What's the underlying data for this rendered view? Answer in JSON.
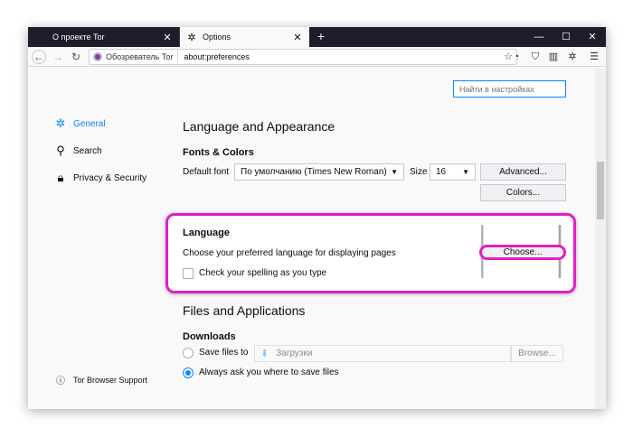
{
  "tabs": [
    {
      "title": "О проекте Tor",
      "active": false
    },
    {
      "title": "Options",
      "active": true
    }
  ],
  "window_controls": {
    "minimize": "—",
    "maximize": "☐",
    "close": "✕"
  },
  "navbar": {
    "identity_label": "Обозреватель Tor",
    "url": "about:preferences"
  },
  "search": {
    "placeholder": "Найти в настройках"
  },
  "sidebar": {
    "items": [
      {
        "label": "General",
        "icon": "gear-icon",
        "selected": true
      },
      {
        "label": "Search",
        "icon": "search-icon",
        "selected": false
      },
      {
        "label": "Privacy & Security",
        "icon": "lock-icon",
        "selected": false
      }
    ],
    "support_label": "Tor Browser Support"
  },
  "lang_appearance": {
    "title": "Language and Appearance",
    "fonts_colors": "Fonts & Colors",
    "default_font_label": "Default font",
    "default_font_value": "По умолчанию (Times New Roman)",
    "size_label": "Size",
    "size_value": "16",
    "advanced_label": "Advanced...",
    "colors_label": "Colors..."
  },
  "language": {
    "title": "Language",
    "description": "Choose your preferred language for displaying pages",
    "choose_label": "Choose...",
    "spellcheck_label": "Check your spelling as you type",
    "spellcheck_checked": false
  },
  "files_apps": {
    "title": "Files and Applications",
    "downloads": "Downloads",
    "save_files_label": "Save files to",
    "save_folder": "Загрузки",
    "browse_label": "Browse...",
    "always_ask_label": "Always ask you where to save files",
    "selected_option": "always_ask"
  },
  "colors": {
    "accent": "#0a84ff",
    "highlight": "#e020c8",
    "tabstrip": "#1e1d2c"
  }
}
